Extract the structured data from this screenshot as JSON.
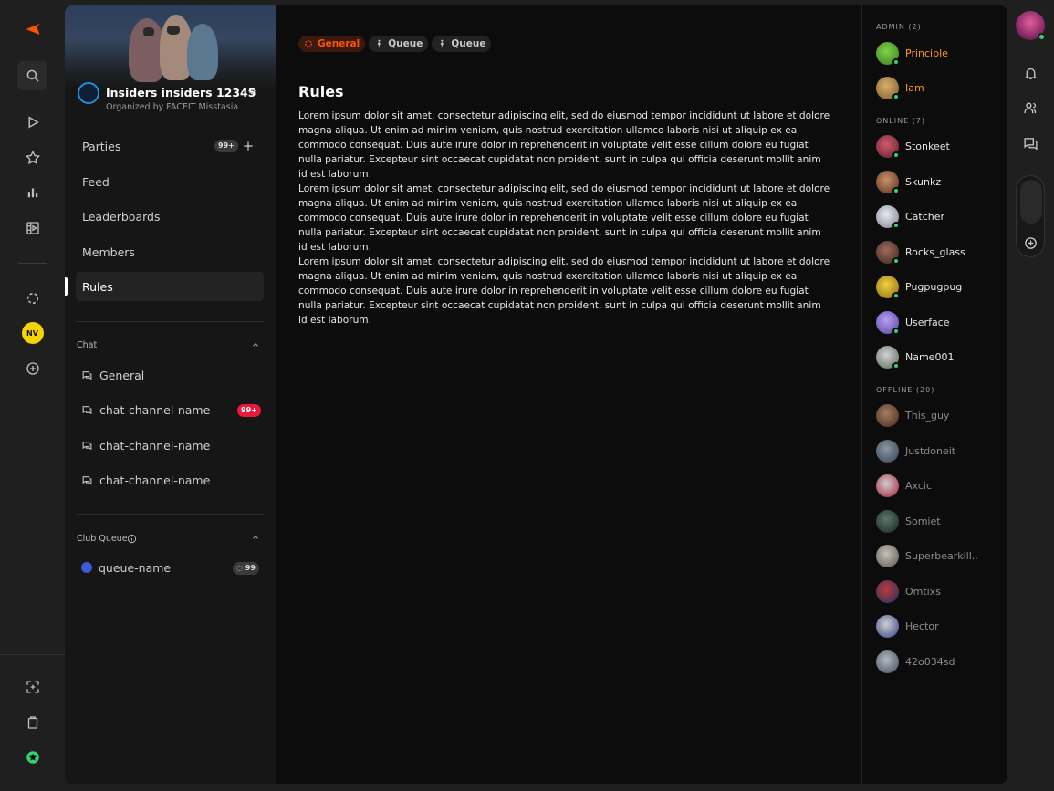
{
  "club": {
    "name": "Insiders insiders 12345",
    "organizer": "Organized by FACEIT Misstasia"
  },
  "nav": {
    "items": [
      {
        "label": "Parties",
        "badge": "99+"
      },
      {
        "label": "Feed"
      },
      {
        "label": "Leaderboards"
      },
      {
        "label": "Members"
      },
      {
        "label": "Rules"
      }
    ],
    "active": "Rules"
  },
  "chat": {
    "title": "Chat",
    "channels": [
      {
        "label": "General"
      },
      {
        "label": "chat-channel-name",
        "badge": "99+"
      },
      {
        "label": "chat-channel-name"
      },
      {
        "label": "chat-channel-name"
      }
    ]
  },
  "club_queue": {
    "title": "Club Queue",
    "queues": [
      {
        "label": "queue-name",
        "count": "99"
      }
    ]
  },
  "tabs": [
    {
      "label": "General",
      "selected": true
    },
    {
      "label": "Queue"
    },
    {
      "label": "Queue"
    }
  ],
  "rules": {
    "title": "Rules",
    "paragraphs": [
      "Lorem ipsum dolor sit amet, consectetur adipiscing elit, sed do eiusmod tempor incididunt ut labore et dolore magna aliqua. Ut enim ad minim veniam, quis nostrud exercitation ullamco laboris nisi ut aliquip ex ea commodo consequat. Duis aute irure dolor in reprehenderit in voluptate velit esse cillum dolore eu fugiat nulla pariatur. Excepteur sint occaecat cupidatat non proident, sunt in culpa qui officia deserunt mollit anim id est laborum.",
      "Lorem ipsum dolor sit amet, consectetur adipiscing elit, sed do eiusmod tempor incididunt ut labore et dolore magna aliqua. Ut enim ad minim veniam, quis nostrud exercitation ullamco laboris nisi ut aliquip ex ea commodo consequat. Duis aute irure dolor in reprehenderit in voluptate velit esse cillum dolore eu fugiat nulla pariatur. Excepteur sint occaecat cupidatat non proident, sunt in culpa qui officia deserunt mollit anim id est laborum.",
      "Lorem ipsum dolor sit amet, consectetur adipiscing elit, sed do eiusmod tempor incididunt ut labore et dolore magna aliqua. Ut enim ad minim veniam, quis nostrud exercitation ullamco laboris nisi ut aliquip ex ea commodo consequat. Duis aute irure dolor in reprehenderit in voluptate velit esse cillum dolore eu fugiat nulla pariatur. Excepteur sint occaecat cupidatat non proident, sunt in culpa qui officia deserunt mollit anim id est laborum."
    ]
  },
  "members": {
    "admin_header": "ADMIN (2)",
    "online_header": "ONLINE (7)",
    "offline_header": "OFFLINE (20)",
    "admins": [
      "Principle",
      "Iam"
    ],
    "online": [
      "Stonkeet",
      "Skunkz",
      "Catcher",
      "Rocks_glass",
      "Pugpugpug",
      "Userface",
      "Name001"
    ],
    "offline": [
      "This_guy",
      "Justdoneit",
      "Axcic",
      "Somiet",
      "Superbearkill..",
      "Omtixs",
      "Hector",
      "42o034sd"
    ]
  },
  "colors": {
    "accent": "#ff5500",
    "admin_name": "#ff9a1a",
    "online_dot": "#33d36f",
    "badge_red": "#e8193c"
  }
}
